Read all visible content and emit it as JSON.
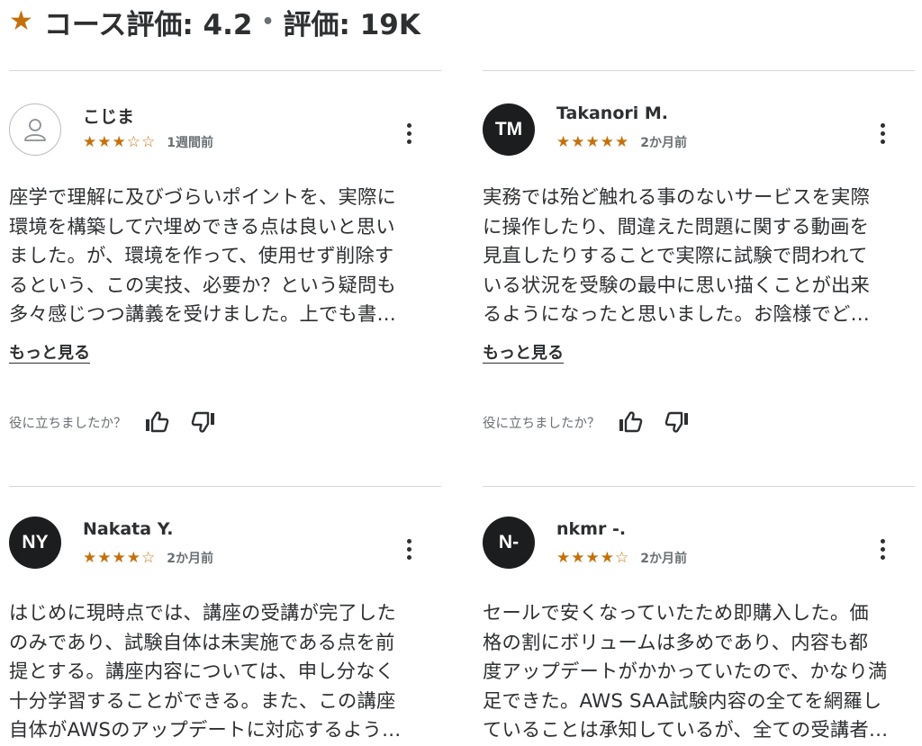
{
  "header": {
    "rating_label": "コース評価: 4.2",
    "separator": "•",
    "count_label": "評価: 19K",
    "star_icon": "star-icon",
    "accent_color": "#c4710d"
  },
  "reviews": [
    {
      "name": "こじま",
      "avatar_initials": "",
      "avatar_type": "user-outline-icon",
      "rating": 3,
      "stars": "★★★☆☆",
      "date": "1週間前",
      "lines": [
        "座学で理解に及びづらいポイントを、実際に",
        "環境を構築して穴埋めできる点は良いと思い",
        "ました。が、環境を作って、使用せず削除す",
        "るという、この実技、必要か？という疑問も",
        "多々感じつつ講義を受けました。上でも書…"
      ],
      "more_label": "もっと見る",
      "helpful_label": "役に立ちましたか？"
    },
    {
      "name": "Takanori M.",
      "avatar_initials": "TM",
      "rating": 5,
      "stars": "★★★★★",
      "date": "2か月前",
      "lines": [
        "実務では殆ど触れる事のないサービスを実際",
        "に操作したり、間違えた問題に関する動画を",
        "見直したりすることで実際に試験で問われて",
        "いる状況を受験の最中に思い描くことが出来",
        "るようになったと思いました。お陰様でど…"
      ],
      "more_label": "もっと見る",
      "helpful_label": "役に立ちましたか？"
    },
    {
      "name": "Nakata Y.",
      "avatar_initials": "NY",
      "rating": 4,
      "stars": "★★★★☆",
      "date": "2か月前",
      "lines": [
        "はじめに現時点では、講座の受講が完了した",
        "のみであり、試験自体は未実施である点を前",
        "提とする。講座内容については、申し分なく",
        "十分学習することができる。また、この講座",
        "自体がAWSのアップデートに対応するよう…"
      ]
    },
    {
      "name": "nkmr -.",
      "avatar_initials": "N-",
      "rating": 4,
      "stars": "★★★★☆",
      "date": "2か月前",
      "lines": [
        "セールで安くなっていたため即購入した。価",
        "格の割にボリュームは多めであり、内容も都",
        "度アップデートがかかっていたので、かなり満",
        "足できた。AWS SAA試験内容の全てを網羅し",
        "ていることは承知しているが、全ての受講者…"
      ]
    }
  ]
}
